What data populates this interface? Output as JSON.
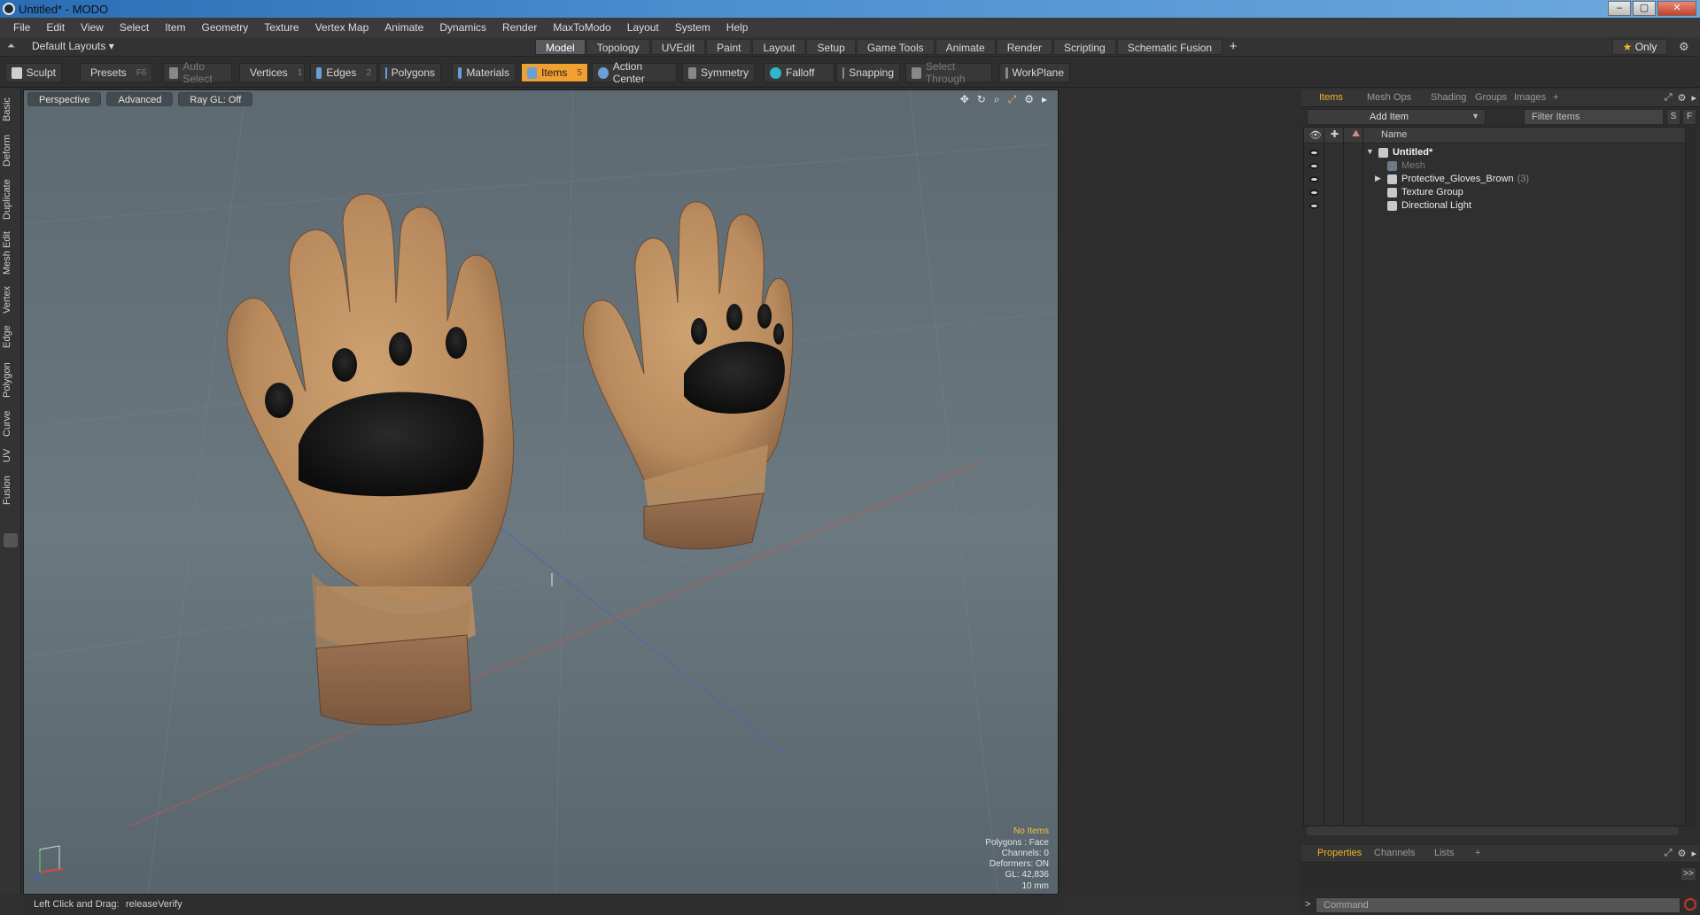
{
  "window": {
    "title": "Untitled* - MODO",
    "minimize": "–",
    "maximize": "▢",
    "close": "✕"
  },
  "menu": [
    "File",
    "Edit",
    "View",
    "Select",
    "Item",
    "Geometry",
    "Texture",
    "Vertex Map",
    "Animate",
    "Dynamics",
    "Render",
    "MaxToModo",
    "Layout",
    "System",
    "Help"
  ],
  "layout": {
    "dropdown": "Default Layouts ▾",
    "tabs": [
      "Model",
      "Topology",
      "UVEdit",
      "Paint",
      "Layout",
      "Setup",
      "Game Tools",
      "Animate",
      "Render",
      "Scripting",
      "Schematic Fusion"
    ],
    "active_tab": "Model",
    "add": "+",
    "only": "Only"
  },
  "toolbar": {
    "sculpt": "Sculpt",
    "presets": "Presets",
    "presets_key": "F6",
    "auto_select": "Auto Select",
    "vertices": "Vertices",
    "vertices_key": "1",
    "edges": "Edges",
    "edges_key": "2",
    "polygons": "Polygons",
    "materials": "Materials",
    "items": "Items",
    "items_key": "5",
    "action_center": "Action Center",
    "symmetry": "Symmetry",
    "falloff": "Falloff",
    "snapping": "Snapping",
    "select_through": "Select Through",
    "workplane": "WorkPlane"
  },
  "left_tabs": [
    "Basic",
    "Deform",
    "Duplicate",
    "Mesh Edit",
    "Vertex",
    "Edge",
    "Polygon",
    "Curve",
    "UV",
    "Fusion"
  ],
  "viewport": {
    "view": "Perspective",
    "mode": "Advanced",
    "raygl": "Ray GL: Off",
    "stats": {
      "no_items": "No Items",
      "polygons": "Polygons : Face",
      "channels": "Channels: 0",
      "deformers": "Deformers: ON",
      "gl": "GL: 42,836",
      "scale": "10 mm"
    }
  },
  "status": {
    "hint": "Left Click and Drag:",
    "action": "releaseVerify"
  },
  "right_panel": {
    "tabs": [
      "Items",
      "Mesh Ops",
      "Shading",
      "Groups",
      "Images"
    ],
    "active_tab": "Items",
    "add_item": "Add Item",
    "filter_placeholder": "Filter Items",
    "s_btn": "S",
    "f_btn": "F",
    "column_name": "Name",
    "tree": [
      {
        "label": "Untitled*",
        "count": "",
        "level": 0,
        "bold": true,
        "dim": false,
        "toggle": "▼"
      },
      {
        "label": "Mesh",
        "count": "",
        "level": 1,
        "bold": false,
        "dim": true,
        "toggle": ""
      },
      {
        "label": "Protective_Gloves_Brown",
        "count": "(3)",
        "level": 1,
        "bold": false,
        "dim": false,
        "toggle": "▶"
      },
      {
        "label": "Texture Group",
        "count": "",
        "level": 1,
        "bold": false,
        "dim": false,
        "toggle": ""
      },
      {
        "label": "Directional Light",
        "count": "",
        "level": 1,
        "bold": false,
        "dim": false,
        "toggle": ""
      }
    ],
    "bottom_tabs": [
      "Properties",
      "Channels",
      "Lists"
    ],
    "bottom_active": "Properties",
    "command_placeholder": "Command",
    "expand": ">>"
  }
}
